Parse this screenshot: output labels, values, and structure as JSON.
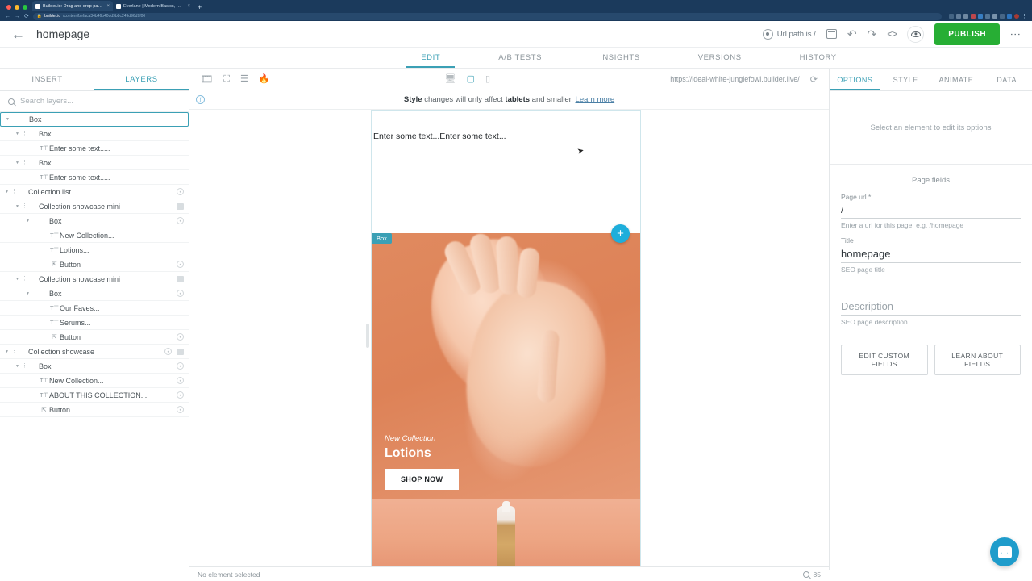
{
  "browser": {
    "tabs": [
      {
        "title": "Builder.io: Drag and drop pag...",
        "favicon": "builder-icon",
        "active": true
      },
      {
        "title": "Everlane | Modern Basics, Sus...",
        "favicon": "everlane-icon",
        "active": false
      }
    ],
    "new_tab_label": "+",
    "nav": {
      "back": "←",
      "forward": "→",
      "reload": "⟳"
    },
    "url_host": "builder.io",
    "url_path": "/content/befaca34b46b40dd9b8c249d96d9f00",
    "lock_icon": "lock-icon"
  },
  "header": {
    "back_label": "←",
    "page_title": "homepage",
    "url_path_chip": "Url path is /",
    "publish_label": "PUBLISH",
    "icons": {
      "target": "target-icon",
      "calendar": "calendar-icon",
      "undo": "undo-icon",
      "redo": "redo-icon",
      "code": "code-icon",
      "preview": "eye-icon",
      "more": "kebab-menu-icon"
    }
  },
  "main_tabs": [
    {
      "label": "EDIT",
      "active": true
    },
    {
      "label": "A/B TESTS",
      "active": false
    },
    {
      "label": "INSIGHTS",
      "active": false
    },
    {
      "label": "VERSIONS",
      "active": false
    },
    {
      "label": "HISTORY",
      "active": false
    }
  ],
  "left_panel": {
    "tabs": [
      {
        "label": "INSERT",
        "active": false
      },
      {
        "label": "LAYERS",
        "active": true
      }
    ],
    "search_placeholder": "Search layers...",
    "search_value": "",
    "layers": [
      {
        "label": "Box",
        "indent": 0,
        "caret": true,
        "dots": "ellipsis",
        "icon": "",
        "selected": true,
        "circle": false,
        "square": false
      },
      {
        "label": "Box",
        "indent": 1,
        "caret": true,
        "dots": "vertical",
        "icon": "",
        "selected": false,
        "circle": false,
        "square": false
      },
      {
        "label": "Enter some text.....",
        "indent": 2,
        "caret": false,
        "dots": "",
        "icon": "text",
        "selected": false,
        "circle": false,
        "square": false
      },
      {
        "label": "Box",
        "indent": 1,
        "caret": true,
        "dots": "vertical",
        "icon": "",
        "selected": false,
        "circle": false,
        "square": false
      },
      {
        "label": "Enter some text.....",
        "indent": 2,
        "caret": false,
        "dots": "",
        "icon": "text",
        "selected": false,
        "circle": false,
        "square": false
      },
      {
        "label": "Collection list",
        "indent": 0,
        "caret": true,
        "dots": "vertical",
        "icon": "",
        "selected": false,
        "circle": true,
        "square": false
      },
      {
        "label": "Collection showcase mini",
        "indent": 1,
        "caret": true,
        "dots": "vertical",
        "icon": "",
        "selected": false,
        "circle": false,
        "square": true
      },
      {
        "label": "Box",
        "indent": 2,
        "caret": true,
        "dots": "vertical",
        "icon": "",
        "selected": false,
        "circle": true,
        "square": false
      },
      {
        "label": "New Collection...",
        "indent": 3,
        "caret": false,
        "dots": "",
        "icon": "text",
        "selected": false,
        "circle": false,
        "square": false
      },
      {
        "label": "Lotions...",
        "indent": 3,
        "caret": false,
        "dots": "",
        "icon": "text",
        "selected": false,
        "circle": false,
        "square": false
      },
      {
        "label": "Button",
        "indent": 3,
        "caret": false,
        "dots": "",
        "icon": "button",
        "selected": false,
        "circle": true,
        "square": false
      },
      {
        "label": "Collection showcase mini",
        "indent": 1,
        "caret": true,
        "dots": "vertical",
        "icon": "",
        "selected": false,
        "circle": false,
        "square": true
      },
      {
        "label": "Box",
        "indent": 2,
        "caret": true,
        "dots": "vertical",
        "icon": "",
        "selected": false,
        "circle": true,
        "square": false
      },
      {
        "label": "Our Faves...",
        "indent": 3,
        "caret": false,
        "dots": "",
        "icon": "text",
        "selected": false,
        "circle": false,
        "square": false
      },
      {
        "label": "Serums...",
        "indent": 3,
        "caret": false,
        "dots": "",
        "icon": "text",
        "selected": false,
        "circle": false,
        "square": false
      },
      {
        "label": "Button",
        "indent": 3,
        "caret": false,
        "dots": "",
        "icon": "button",
        "selected": false,
        "circle": true,
        "square": false
      },
      {
        "label": "Collection showcase",
        "indent": 0,
        "caret": true,
        "dots": "vertical",
        "icon": "",
        "selected": false,
        "circle": true,
        "square": true
      },
      {
        "label": "Box",
        "indent": 1,
        "caret": true,
        "dots": "vertical",
        "icon": "",
        "selected": false,
        "circle": true,
        "square": false
      },
      {
        "label": "New Collection...",
        "indent": 2,
        "caret": false,
        "dots": "",
        "icon": "text",
        "selected": false,
        "circle": true,
        "square": false
      },
      {
        "label": "ABOUT THIS COLLECTION...",
        "indent": 2,
        "caret": false,
        "dots": "",
        "icon": "text",
        "selected": false,
        "circle": true,
        "square": false
      },
      {
        "label": "Button",
        "indent": 2,
        "caret": false,
        "dots": "",
        "icon": "button",
        "selected": false,
        "circle": true,
        "square": false
      }
    ]
  },
  "canvas": {
    "toolbar_icons": [
      "film-strip-icon",
      "fullscreen-icon",
      "layout-rows-icon",
      "flame-icon"
    ],
    "devices": [
      {
        "name": "desktop-icon",
        "active": false
      },
      {
        "name": "tablet-icon",
        "active": true
      },
      {
        "name": "mobile-icon",
        "active": false
      }
    ],
    "preview_url": "https://ideal-white-junglefowl.builder.live/",
    "refresh_icon": "refresh-icon",
    "notice": {
      "icon": "info-icon",
      "prefix_bold": "Style",
      "mid": " changes will only affect ",
      "bold2": "tablets",
      "suffix": " and smaller. ",
      "link": "Learn more"
    },
    "content": {
      "text_block": "Enter some text...Enter some text...",
      "box_badge": "Box",
      "add_button": "+",
      "hero_kicker": "New Collection",
      "hero_title": "Lotions",
      "hero_cta": "SHOP NOW"
    }
  },
  "right_panel": {
    "tabs": [
      {
        "label": "OPTIONS",
        "active": true
      },
      {
        "label": "STYLE",
        "active": false
      },
      {
        "label": "ANIMATE",
        "active": false
      },
      {
        "label": "DATA",
        "active": false
      }
    ],
    "empty_message": "Select an element to edit its options",
    "page_fields_title": "Page fields",
    "fields": [
      {
        "label": "Page url *",
        "value": "/",
        "placeholder": "",
        "hint": "Enter a url for this page, e.g. /homepage"
      },
      {
        "label": "Title",
        "value": "homepage",
        "placeholder": "",
        "hint": "SEO page title"
      },
      {
        "label": "",
        "value": "",
        "placeholder": "Description",
        "hint": "SEO page description"
      }
    ],
    "buttons": [
      {
        "label": "EDIT CUSTOM FIELDS"
      },
      {
        "label": "LEARN ABOUT FIELDS"
      }
    ]
  },
  "statusbar": {
    "selection_text": "No element selected",
    "zoom_icon": "magnifier-icon",
    "zoom_value": "85"
  },
  "intercom": {
    "name": "intercom-chat-bubble"
  },
  "colors": {
    "accent": "#3ba0b5",
    "publish_green": "#27ae34",
    "browser_chrome": "#1b3a5c",
    "fab_blue": "#1eaedb",
    "hero_orange": "#e08a5f"
  }
}
